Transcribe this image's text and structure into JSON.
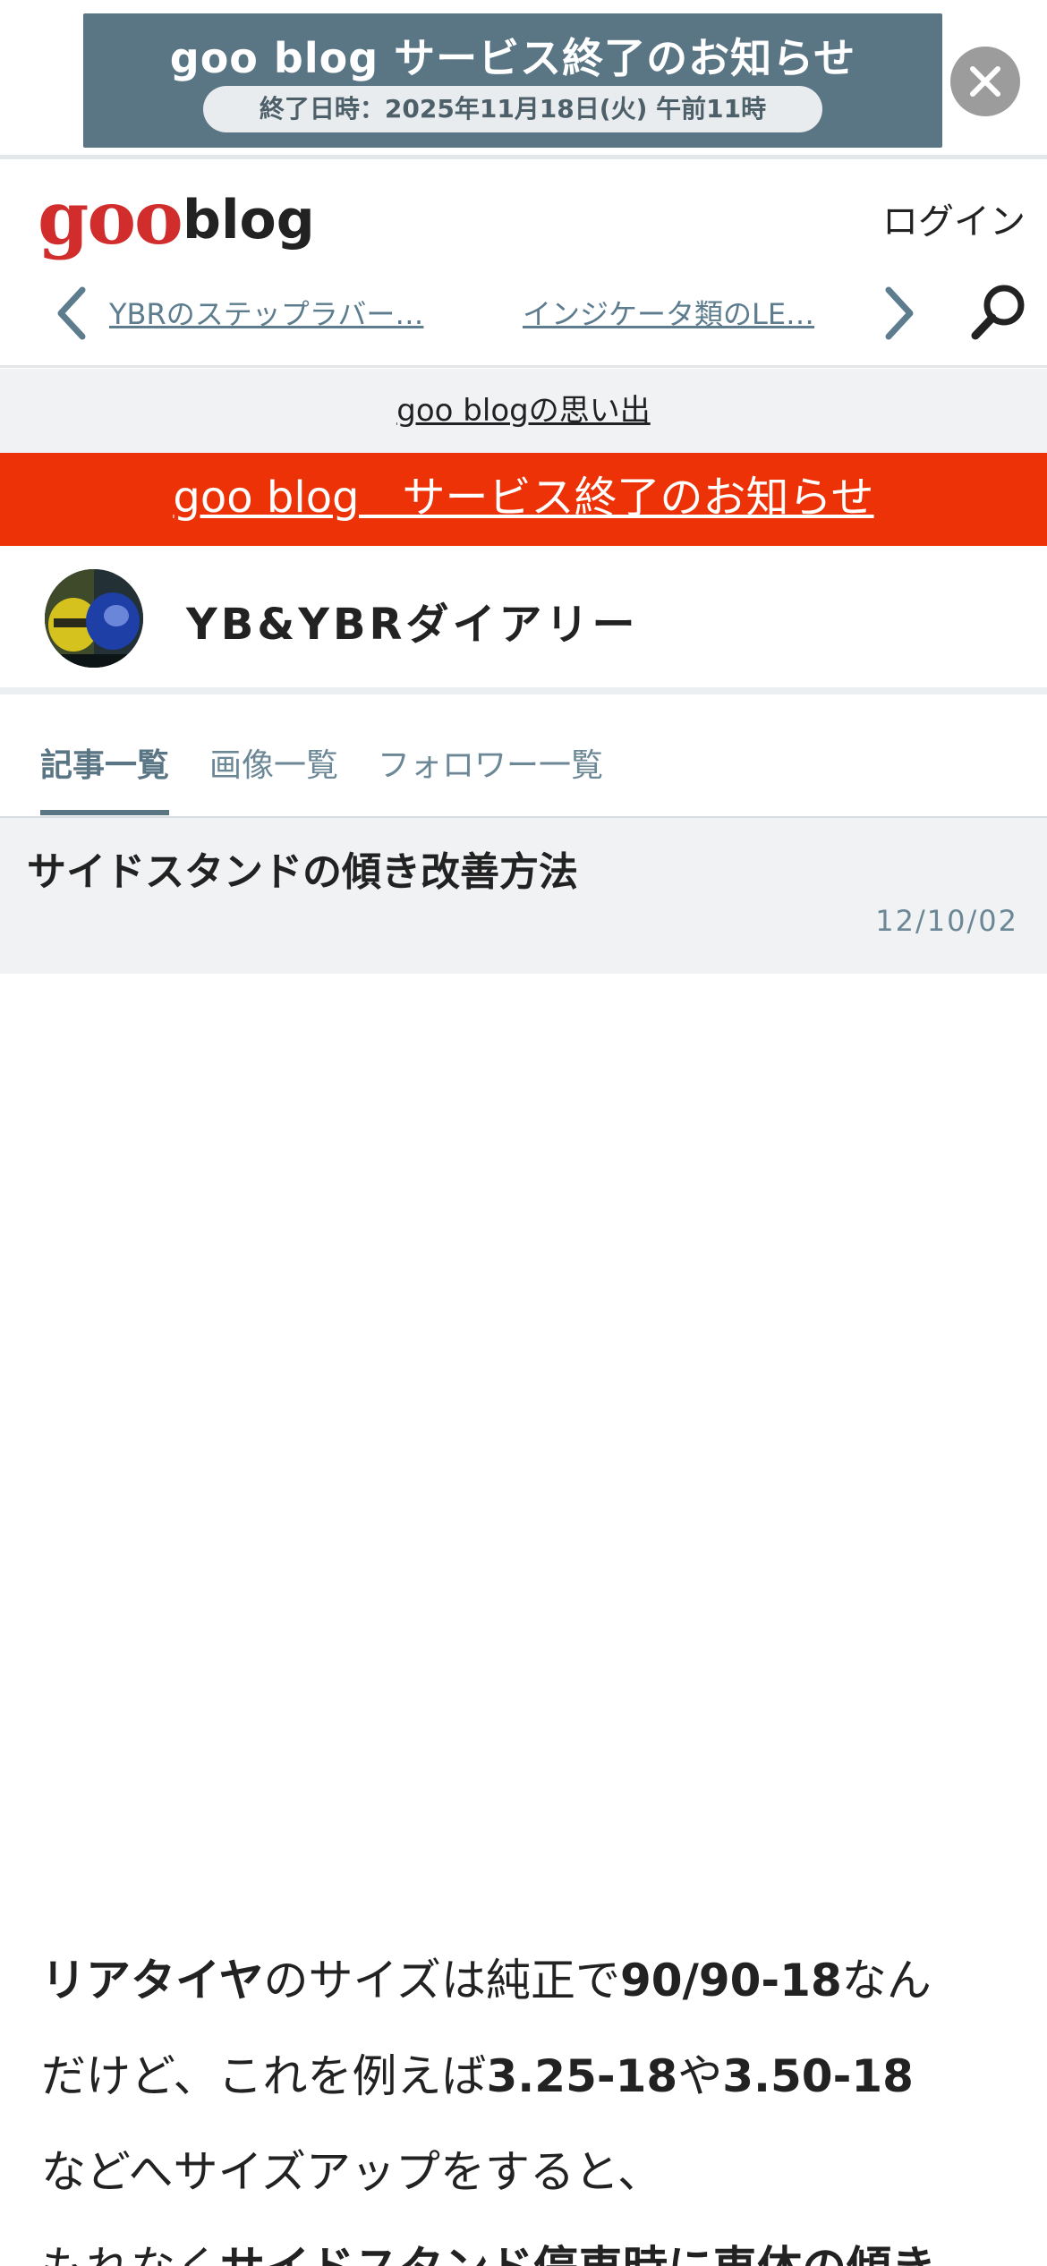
{
  "ad": {
    "title": "goo blog サービス終了のお知らせ",
    "subtitle": "終了日時：2025年11月18日(火) 午前11時",
    "close_icon": "close-icon"
  },
  "header": {
    "logo_goo": "goo",
    "logo_blog": "blog",
    "login": "ログイン",
    "prev_post": "YBRのステップラバー…",
    "next_post": "インジケータ類のLE…",
    "search_icon": "search-icon"
  },
  "memories_link": "goo blogの思い出",
  "notice": "goo blog　サービス終了のお知らせ",
  "blog": {
    "title": "YB&YBRダイアリー"
  },
  "tabs": [
    {
      "label": "記事一覧"
    },
    {
      "label": "画像一覧"
    },
    {
      "label": "フォロワー一覧"
    }
  ],
  "article": {
    "title": "サイドスタンドの傾き改善方法",
    "date": "12/10/02"
  },
  "body": {
    "l1_a": "リアタイヤ",
    "l1_b": "のサイズは純正で",
    "l1_c": "90/90-18",
    "l1_d": "なん",
    "l2_a": "だけど、これを例えば",
    "l2_b": "3.25-18",
    "l2_c": "や",
    "l2_d": "3.50-18",
    "l3": "などへサイズアップをすると、",
    "l4_a": "もれなく",
    "l4_b": "サイドスタンド停車時に車体の傾き"
  },
  "colors": {
    "brand_red": "#d22d2d",
    "notice_red": "#ec3206",
    "link_blue_gray": "#5d7d8f",
    "ad_banner": "#5a7685"
  }
}
